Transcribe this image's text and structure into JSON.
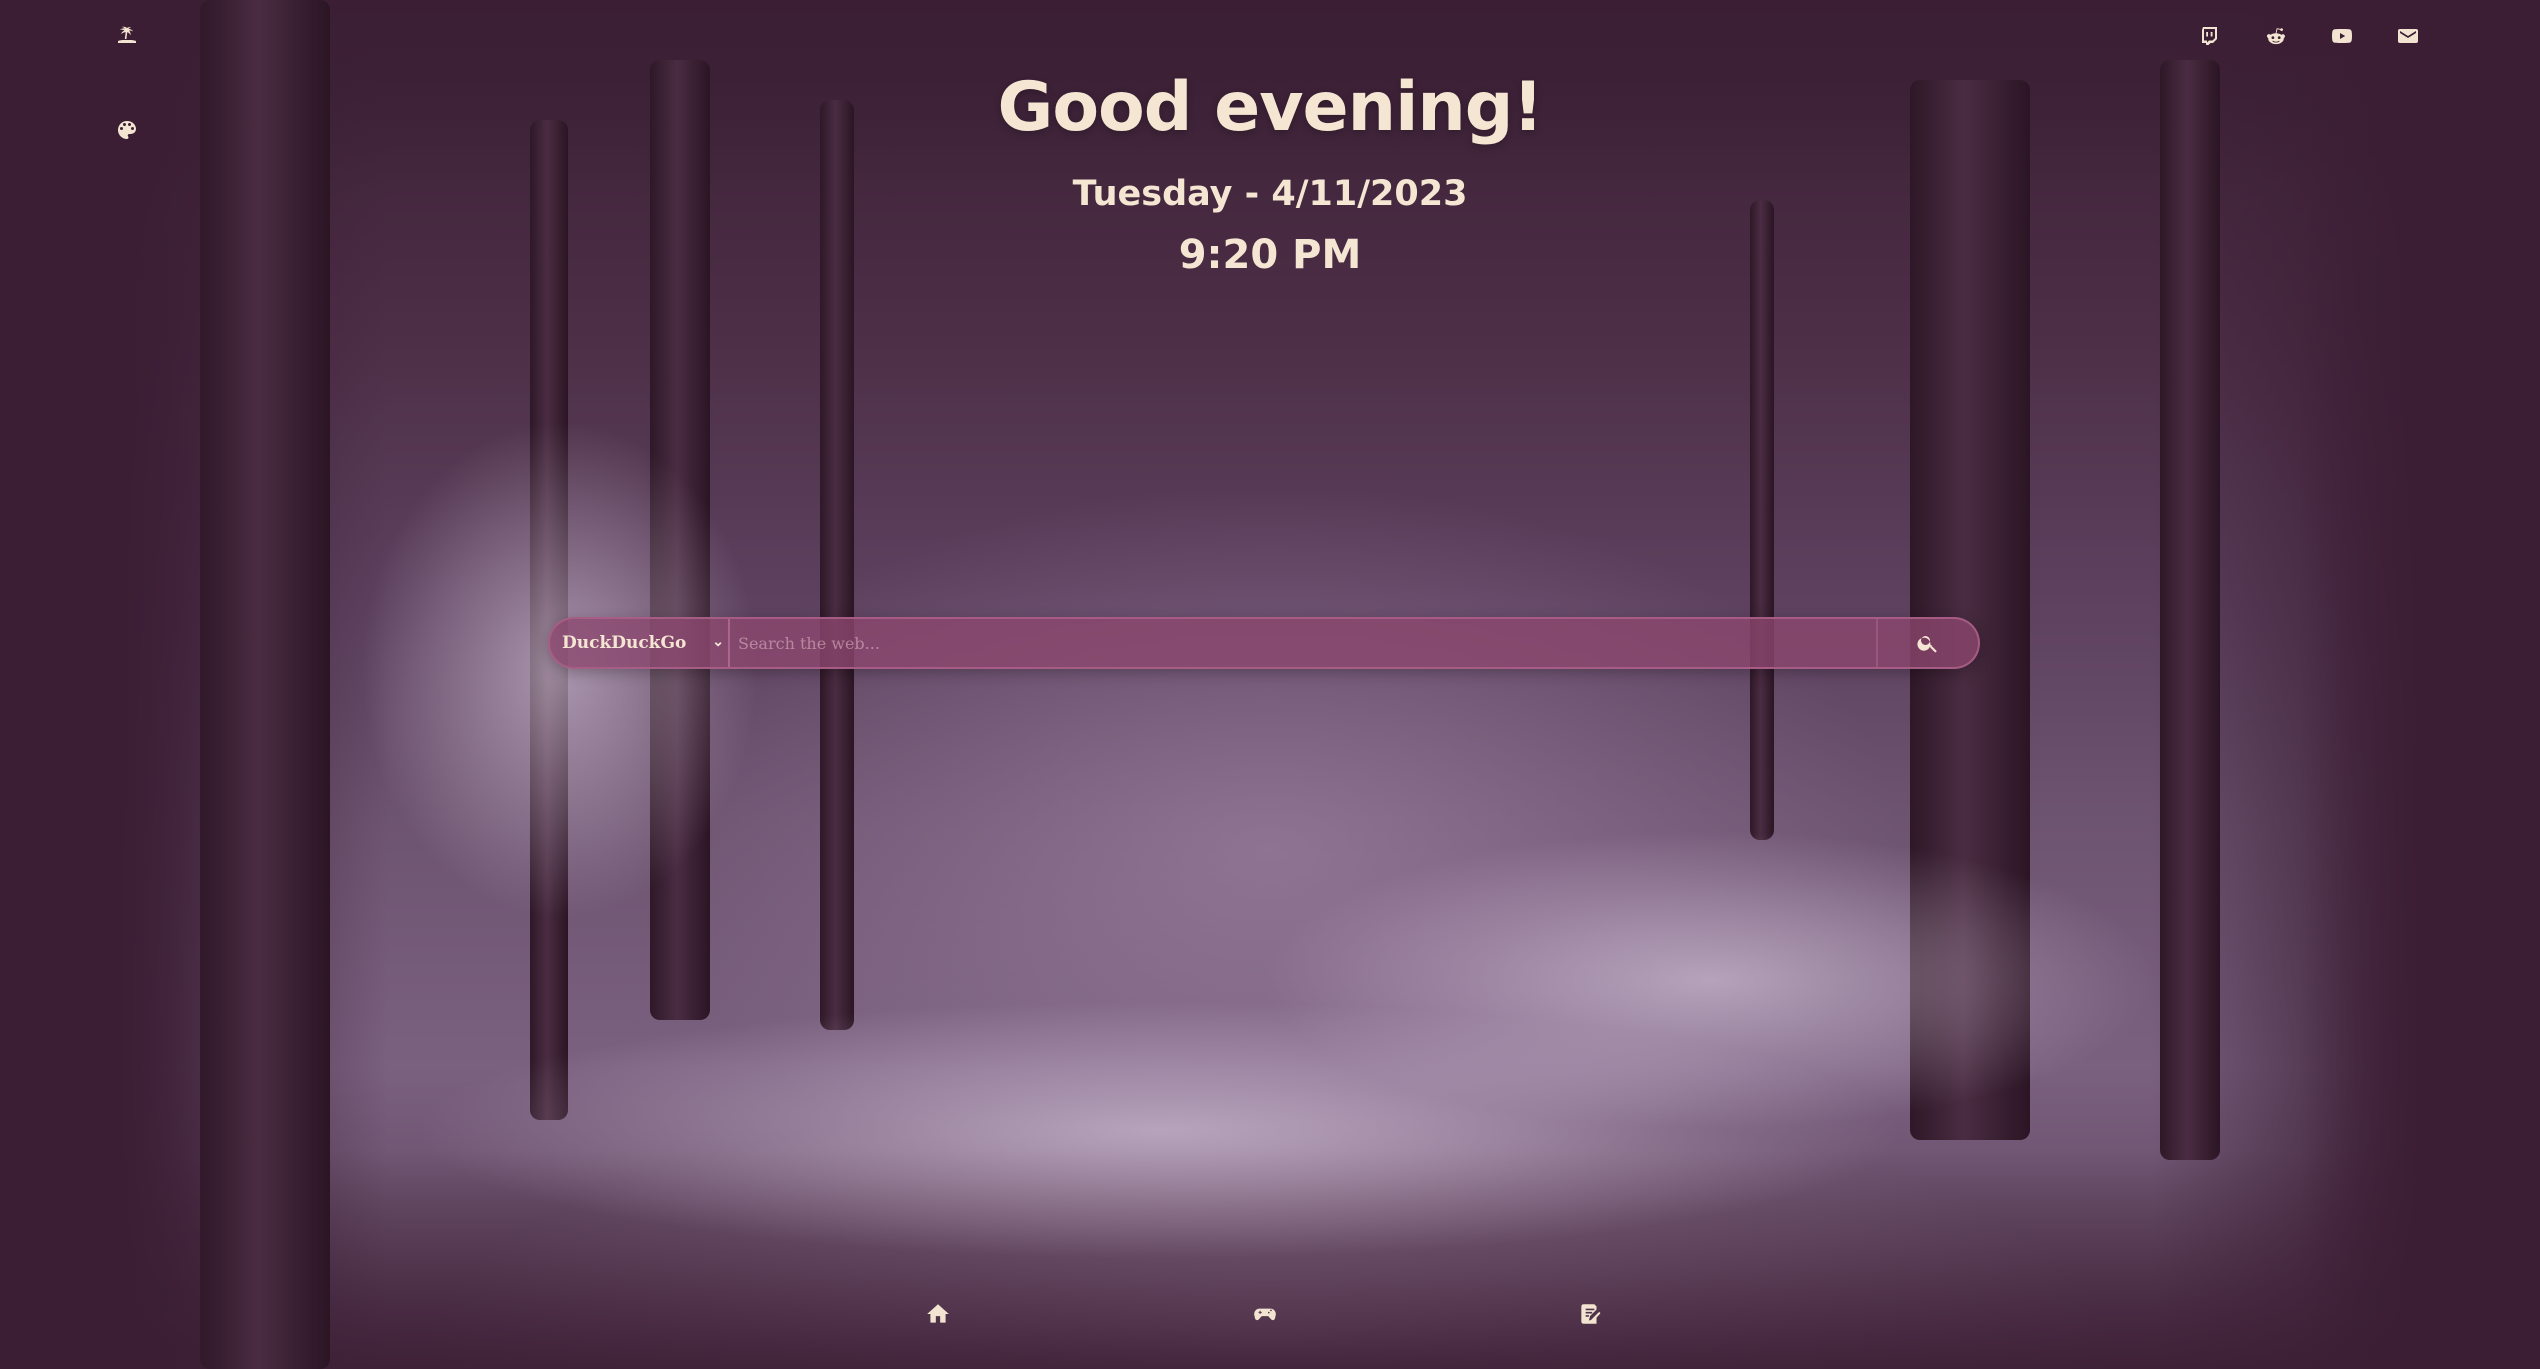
{
  "greeting": "Good evening!",
  "date": "Tuesday - 4/11/2023",
  "time": "9:20 PM",
  "search": {
    "engine": "DuckDuckGo",
    "placeholder": "Search the web..."
  },
  "top_left_icons": [
    "island-icon",
    "palette-icon"
  ],
  "social_links": [
    "twitch-icon",
    "reddit-icon",
    "youtube-icon",
    "mail-icon"
  ],
  "bottom_nav": [
    "home-icon",
    "gamepad-icon",
    "notes-icon"
  ],
  "colors": {
    "background": "#3b1e34",
    "text": "#f5e6d3",
    "search_bar": "#8c466e"
  }
}
